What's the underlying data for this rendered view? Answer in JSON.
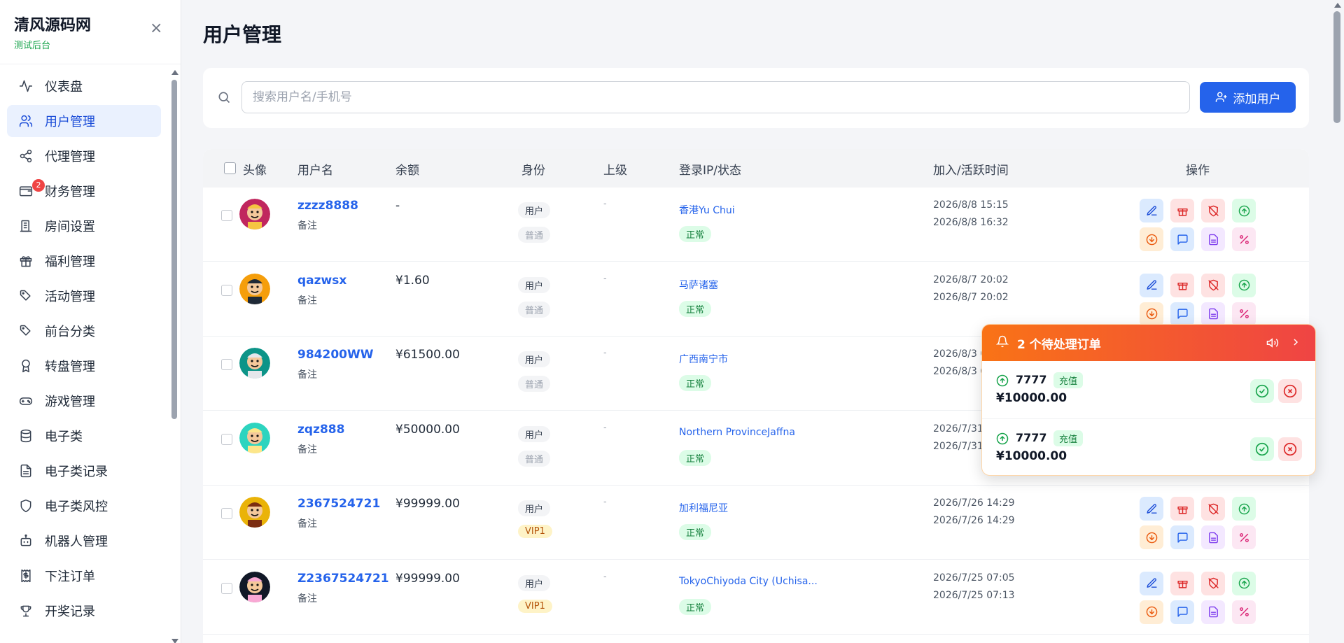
{
  "sidebar": {
    "brand_title": "清风源码网",
    "brand_sub": "测试后台",
    "items": [
      {
        "label": "仪表盘",
        "icon": "activity-icon"
      },
      {
        "label": "用户管理",
        "icon": "users-icon",
        "active": true
      },
      {
        "label": "代理管理",
        "icon": "share-icon"
      },
      {
        "label": "财务管理",
        "icon": "wallet-icon",
        "badge": "2"
      },
      {
        "label": "房间设置",
        "icon": "building-icon"
      },
      {
        "label": "福利管理",
        "icon": "gift-icon"
      },
      {
        "label": "活动管理",
        "icon": "tags-icon"
      },
      {
        "label": "前台分类",
        "icon": "tags-icon"
      },
      {
        "label": "转盘管理",
        "icon": "award-icon"
      },
      {
        "label": "游戏管理",
        "icon": "gamepad-icon"
      },
      {
        "label": "电子类",
        "icon": "database-icon"
      },
      {
        "label": "电子类记录",
        "icon": "file-text-icon"
      },
      {
        "label": "电子类风控",
        "icon": "shield-icon"
      },
      {
        "label": "机器人管理",
        "icon": "bot-icon"
      },
      {
        "label": "下注订单",
        "icon": "receipt-icon"
      },
      {
        "label": "开奖记录",
        "icon": "trophy-icon"
      }
    ]
  },
  "main": {
    "title": "用户管理",
    "search_placeholder": "搜索用户名/手机号",
    "add_button": "添加用户"
  },
  "table": {
    "headers": {
      "avatar": "头像",
      "username": "用户名",
      "balance": "余额",
      "identity": "身份",
      "parent": "上级",
      "ip_status": "登录IP/状态",
      "time": "加入/活跃时间",
      "actions": "操作"
    },
    "rows": [
      {
        "username": "zzzz8888",
        "note": "备注",
        "balance": "-",
        "identity": "用户",
        "level": "普通",
        "parent": "-",
        "ip": "香港Yu Chui",
        "status": "正常",
        "joined": "2026/8/8 15:15",
        "active": "2026/8/8 16:32"
      },
      {
        "username": "qazwsx",
        "note": "备注",
        "balance": "¥1.60",
        "identity": "用户",
        "level": "普通",
        "parent": "-",
        "ip": "马萨诸塞",
        "status": "正常",
        "joined": "2026/8/7 20:02",
        "active": "2026/8/7 20:02"
      },
      {
        "username": "984200WW",
        "note": "备注",
        "balance": "¥61500.00",
        "identity": "用户",
        "level": "普通",
        "parent": "-",
        "ip": "广西南宁市",
        "status": "正常",
        "joined": "2026/8/3 0",
        "active": "2026/8/3 0"
      },
      {
        "username": "zqz888",
        "note": "备注",
        "balance": "¥50000.00",
        "identity": "用户",
        "level": "普通",
        "parent": "-",
        "ip": "Northern ProvinceJaffna",
        "status": "正常",
        "joined": "2026/7/31",
        "active": "2026/7/31"
      },
      {
        "username": "2367524721",
        "note": "备注",
        "balance": "¥99999.00",
        "identity": "用户",
        "level": "VIP1",
        "parent": "-",
        "ip": "加利福尼亚",
        "status": "正常",
        "joined": "2026/7/26 14:29",
        "active": "2026/7/26 14:29"
      },
      {
        "username": "Z2367524721",
        "note": "备注",
        "balance": "¥99999.00",
        "identity": "用户",
        "level": "VIP1",
        "parent": "-",
        "ip": "TokyoChiyoda City (Uchisa...",
        "status": "正常",
        "joined": "2026/7/25 07:05",
        "active": "2026/7/25 07:13"
      }
    ]
  },
  "notification": {
    "title": "2 个待处理订单",
    "orders": [
      {
        "user": "7777",
        "type": "充值",
        "amount": "¥10000.00"
      },
      {
        "user": "7777",
        "type": "充值",
        "amount": "¥10000.00"
      }
    ]
  },
  "colors": {
    "accent": "#2563eb",
    "notif_from": "#f97316",
    "notif_to": "#ef4444"
  }
}
